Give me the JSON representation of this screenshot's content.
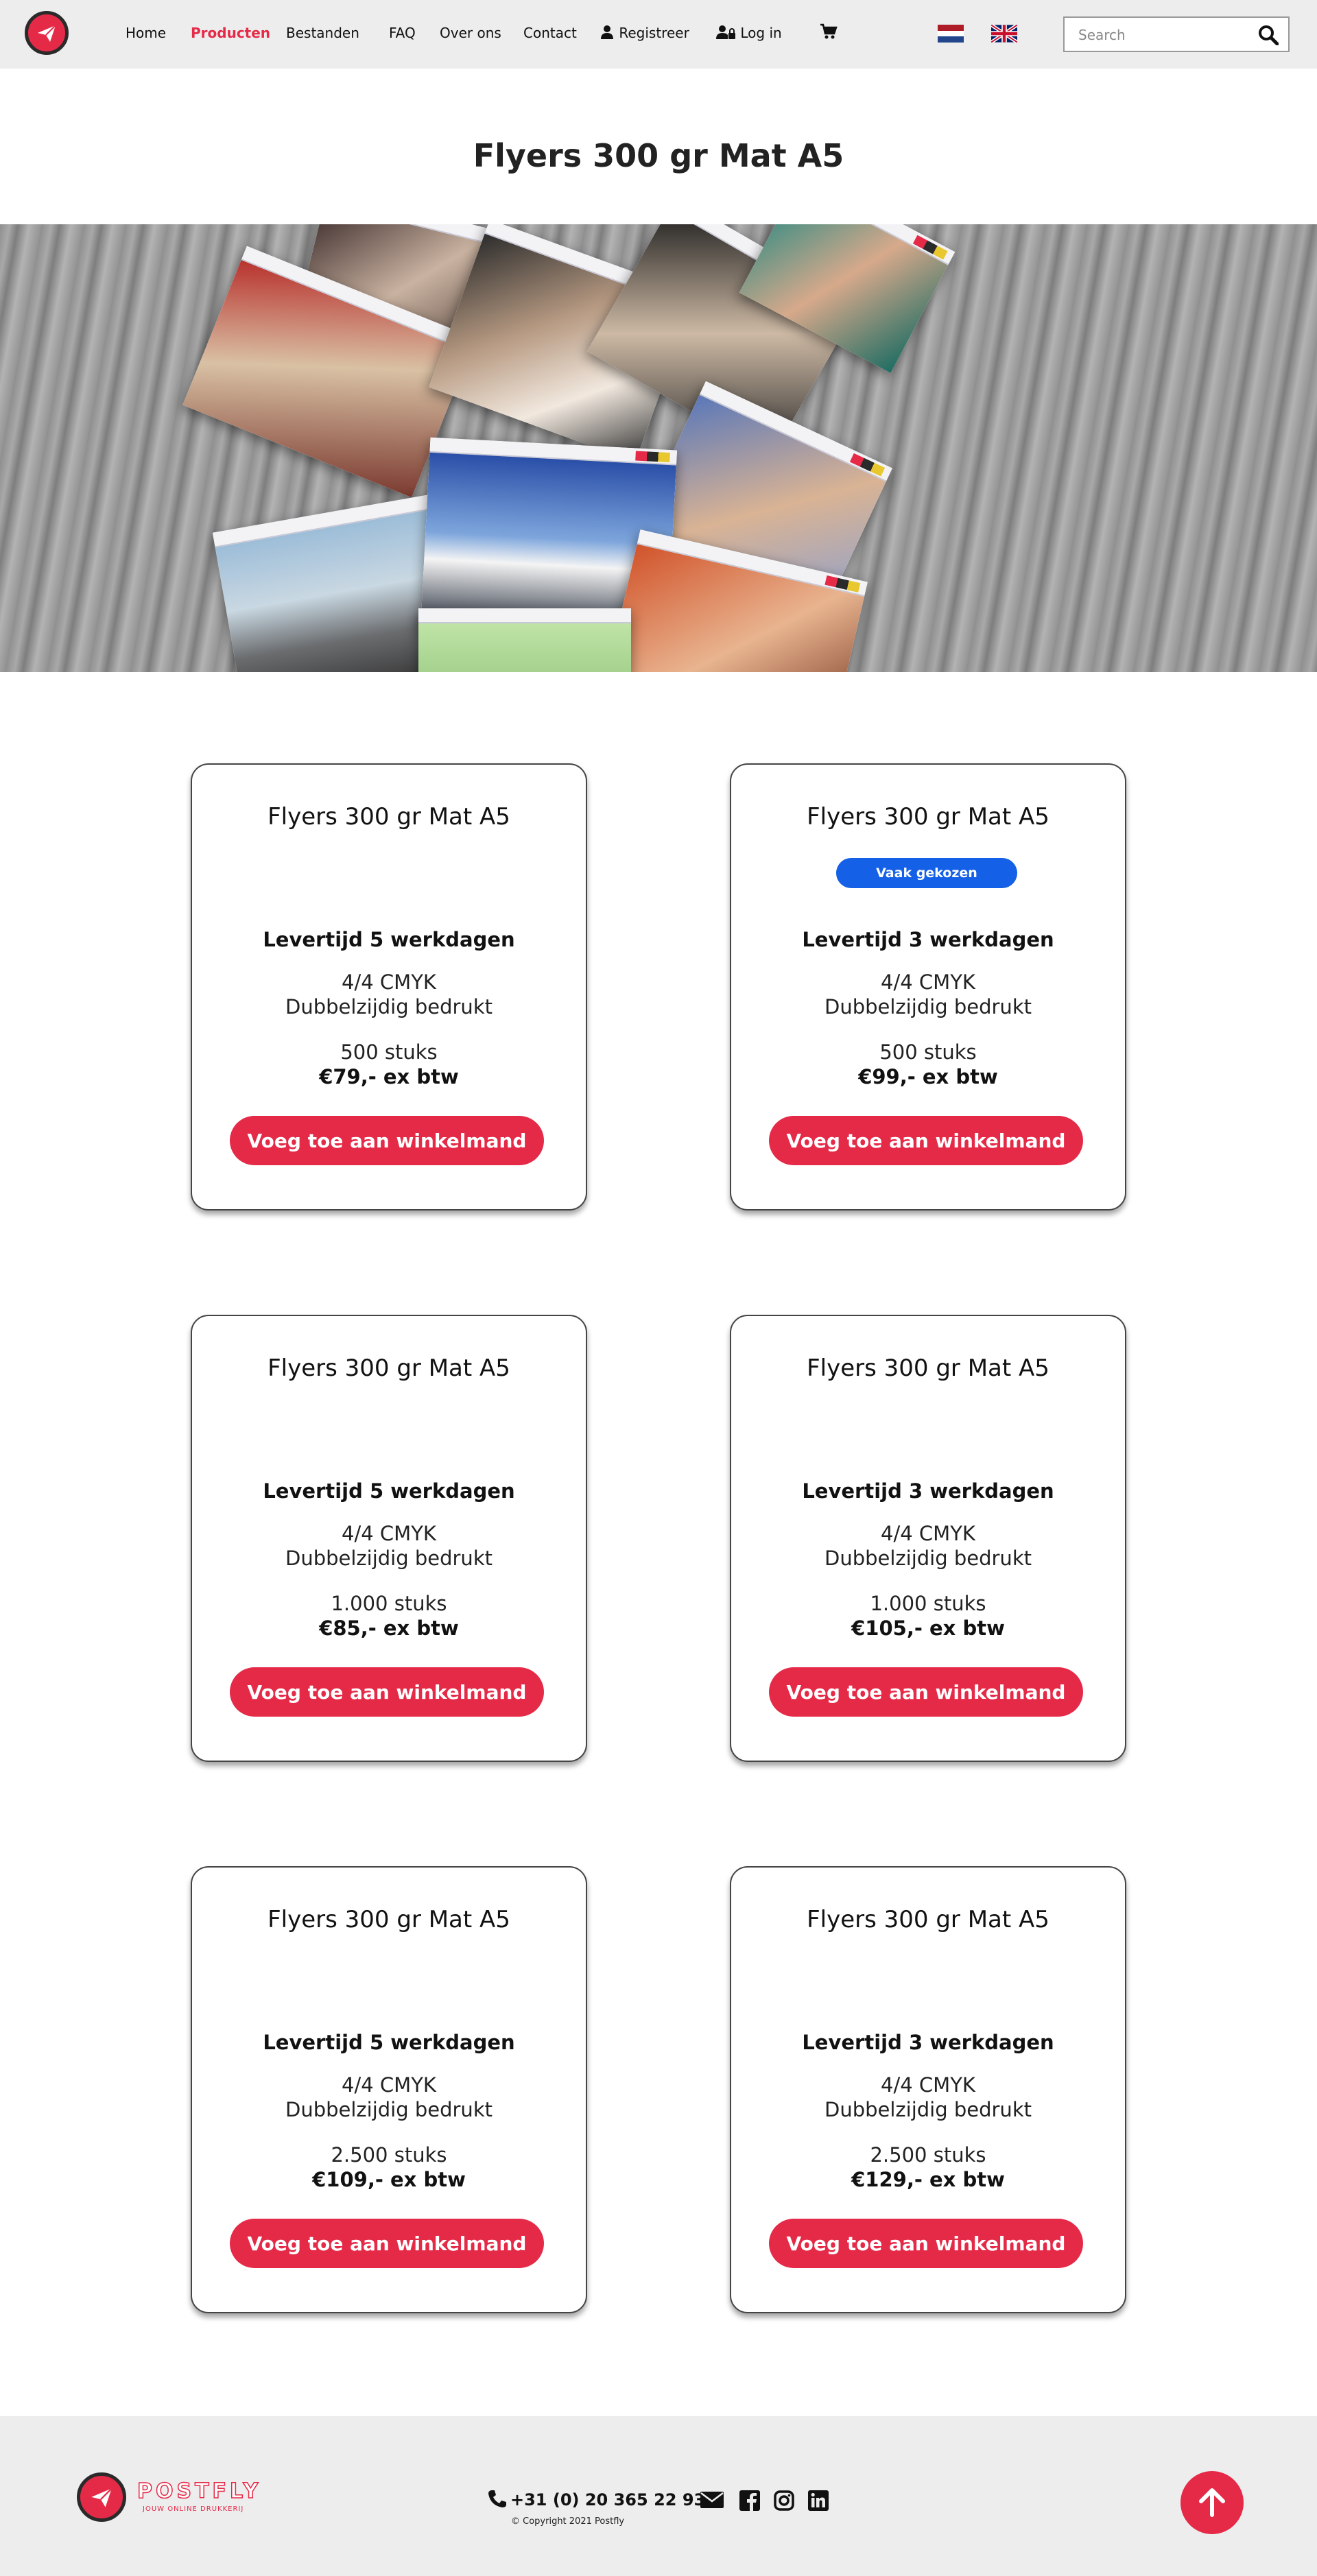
{
  "nav": {
    "links": [
      "Home",
      "Producten",
      "Bestanden",
      "FAQ",
      "Over ons",
      "Contact"
    ],
    "active": "Producten",
    "register": "Registreer",
    "login": "Log in",
    "search_placeholder": "Search",
    "languages": [
      "nl-flag-icon",
      "uk-flag-icon"
    ]
  },
  "page": {
    "title": "Flyers 300 gr Mat A5"
  },
  "products": [
    {
      "title": "Flyers 300 gr Mat A5",
      "badge": "",
      "lead": "Levertijd 5 werkdagen",
      "spec1": "4/4 CMYK",
      "spec2": "Dubbelzijdig bedrukt",
      "qty": "500 stuks",
      "price": "€79,- ex btw",
      "cta": "Voeg toe aan winkelmand"
    },
    {
      "title": "Flyers 300 gr Mat A5",
      "badge": "Vaak gekozen",
      "lead": "Levertijd 3 werkdagen",
      "spec1": "4/4 CMYK",
      "spec2": "Dubbelzijdig bedrukt",
      "qty": "500 stuks",
      "price": "€99,- ex btw",
      "cta": "Voeg toe aan winkelmand"
    },
    {
      "title": "Flyers 300 gr Mat A5",
      "badge": "",
      "lead": "Levertijd 5 werkdagen",
      "spec1": "4/4 CMYK",
      "spec2": "Dubbelzijdig bedrukt",
      "qty": "1.000 stuks",
      "price": "€85,- ex btw",
      "cta": "Voeg toe aan winkelmand"
    },
    {
      "title": "Flyers 300 gr Mat A5",
      "badge": "",
      "lead": "Levertijd 3 werkdagen",
      "spec1": "4/4 CMYK",
      "spec2": "Dubbelzijdig bedrukt",
      "qty": "1.000 stuks",
      "price": "€105,- ex btw",
      "cta": "Voeg toe aan winkelmand"
    },
    {
      "title": "Flyers 300 gr Mat A5",
      "badge": "",
      "lead": "Levertijd 5 werkdagen",
      "spec1": "4/4 CMYK",
      "spec2": "Dubbelzijdig bedrukt",
      "qty": "2.500 stuks",
      "price": "€109,- ex btw",
      "cta": "Voeg toe aan winkelmand"
    },
    {
      "title": "Flyers 300 gr Mat A5",
      "badge": "",
      "lead": "Levertijd 3 werkdagen",
      "spec1": "4/4 CMYK",
      "spec2": "Dubbelzijdig bedrukt",
      "qty": "2.500 stuks",
      "price": "€129,- ex btw",
      "cta": "Voeg toe aan winkelmand"
    }
  ],
  "footer": {
    "brand": "POSTFLY",
    "tagline": "JOUW ONLINE DRUKKERIJ",
    "phone": "+31 (0) 20 365 22 93",
    "copyright": "© Copyright 2021 Postfly",
    "social_icons": [
      "envelope-icon",
      "facebook-icon",
      "instagram-icon",
      "linkedin-icon"
    ]
  },
  "colors": {
    "accent": "#e52a48",
    "badge": "#1460e6",
    "nav_bg": "#ededed",
    "footer_bg": "#ededed"
  }
}
